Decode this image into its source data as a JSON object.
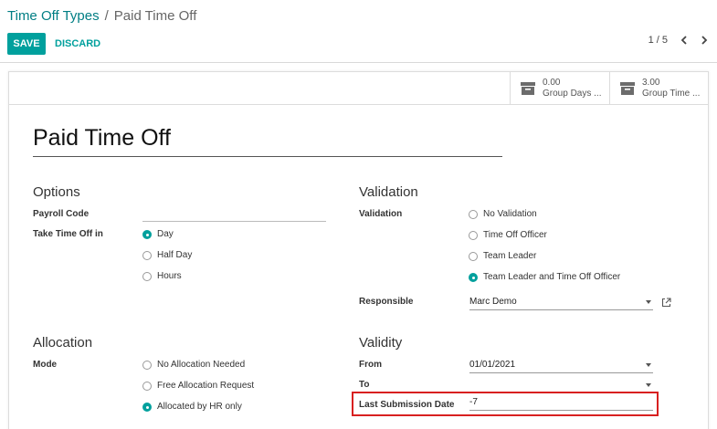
{
  "breadcrumb": {
    "parent": "Time Off Types",
    "separator": "/",
    "current": "Paid Time Off"
  },
  "toolbar": {
    "save_label": "SAVE",
    "discard_label": "DISCARD"
  },
  "pager": {
    "text": "1 / 5"
  },
  "stats": [
    {
      "value": "0.00",
      "label": "Group Days ...",
      "icon": "archive-box-icon"
    },
    {
      "value": "3.00",
      "label": "Group Time ...",
      "icon": "archive-box-icon"
    }
  ],
  "record": {
    "name": "Paid Time Off"
  },
  "options": {
    "heading": "Options",
    "payroll_code_label": "Payroll Code",
    "payroll_code_value": "",
    "take_time_off_label": "Take Time Off in",
    "take_time_off_choices": [
      {
        "label": "Day",
        "selected": true
      },
      {
        "label": "Half Day",
        "selected": false
      },
      {
        "label": "Hours",
        "selected": false
      }
    ]
  },
  "validation": {
    "heading": "Validation",
    "validation_label": "Validation",
    "choices": [
      {
        "label": "No Validation",
        "selected": false
      },
      {
        "label": "Time Off Officer",
        "selected": false
      },
      {
        "label": "Team Leader",
        "selected": false
      },
      {
        "label": "Team Leader and Time Off Officer",
        "selected": true
      }
    ],
    "responsible_label": "Responsible",
    "responsible_value": "Marc Demo"
  },
  "allocation": {
    "heading": "Allocation",
    "mode_label": "Mode",
    "choices": [
      {
        "label": "No Allocation Needed",
        "selected": false
      },
      {
        "label": "Free Allocation Request",
        "selected": false
      },
      {
        "label": "Allocated by HR only",
        "selected": true
      }
    ]
  },
  "validity": {
    "heading": "Validity",
    "from_label": "From",
    "from_value": "01/01/2021",
    "to_label": "To",
    "to_value": "",
    "last_submission_label": "Last Submission Date",
    "last_submission_value": "-7"
  },
  "colors": {
    "accent": "#00a09d",
    "link": "#017e84",
    "highlight": "#d82020"
  }
}
